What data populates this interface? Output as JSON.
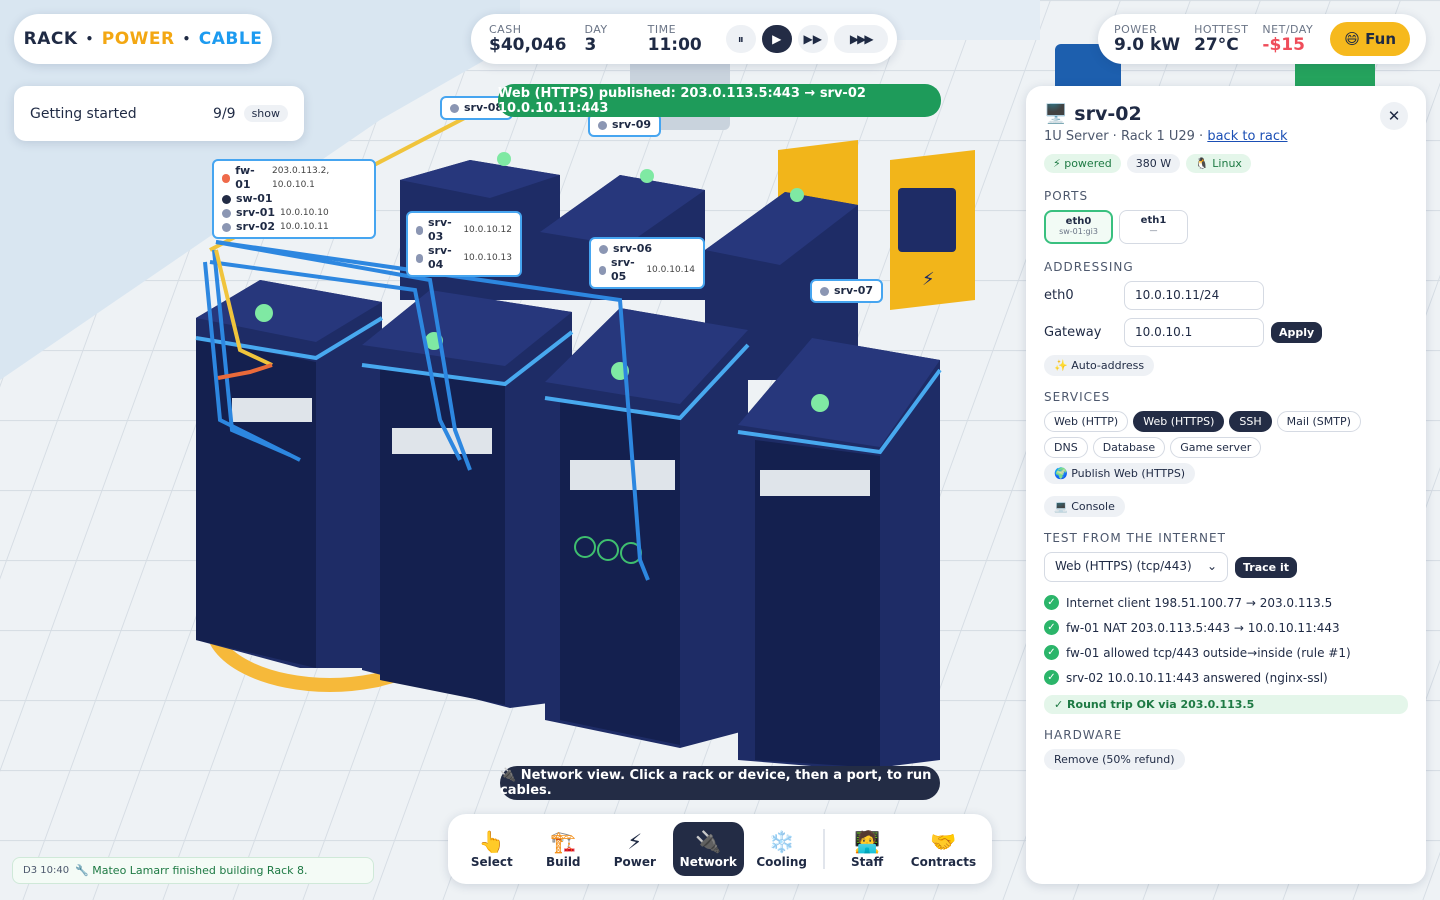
{
  "brand": {
    "w1": "RACK",
    "w2": "POWER",
    "w3": "CABLE",
    "sep": "•"
  },
  "getting_started": {
    "label": "Getting started",
    "count": "9/9",
    "show": "show"
  },
  "topbar": {
    "cash_k": "CASH",
    "cash_v": "$40,046",
    "day_k": "DAY",
    "day_v": "3",
    "time_k": "TIME",
    "time_v": "11:00",
    "pause": "⏸",
    "play": "▶",
    "ff": "▶▶",
    "fff": "▶▶▶"
  },
  "rightbar": {
    "power_k": "POWER",
    "power_v": "9.0 kW",
    "hot_k": "HOTTEST",
    "hot_v": "27°C",
    "net_k": "NET/DAY",
    "net_v": "-$15",
    "fun": "😄 Fun"
  },
  "toast": "Web (HTTPS) published: 203.0.113.5:443 → srv-02 10.0.10.11:443",
  "panel": {
    "title": "🖥️ srv-02",
    "sub": "1U Server · Rack 1 U29 · ",
    "back": "back to rack",
    "close": "✕",
    "tags": [
      "⚡ powered",
      "380 W",
      "🐧 Linux"
    ],
    "ports_h": "PORTS",
    "ports": [
      {
        "name": "eth0",
        "peer": "sw-01:gi3"
      },
      {
        "name": "eth1",
        "peer": "—"
      }
    ],
    "addr_h": "ADDRESSING",
    "eth0_l": "eth0",
    "eth0_v": "10.0.10.11/24",
    "gw_l": "Gateway",
    "gw_v": "10.0.10.1",
    "apply": "Apply",
    "auto": "✨ Auto-address",
    "svc_h": "SERVICES",
    "services": [
      "Web (HTTP)",
      "Web (HTTPS)",
      "SSH",
      "Mail (SMTP)",
      "DNS",
      "Database",
      "Game server"
    ],
    "publish": "🌍 Publish Web (HTTPS)",
    "console": "💻 Console",
    "test_h": "TEST FROM THE INTERNET",
    "test_sel": "Web (HTTPS) (tcp/443)",
    "trace": "Trace it",
    "checks": [
      "Internet client 198.51.100.77 → 203.0.113.5",
      "fw-01 NAT 203.0.113.5:443 → 10.0.10.11:443",
      "fw-01 allowed tcp/443 outside→inside (rule #1)",
      "srv-02 10.0.10.11:443 answered (nginx-ssl)"
    ],
    "ok": "✓ Round trip OK via 203.0.113.5",
    "hw_h": "HARDWARE",
    "remove": "Remove (50% refund)"
  },
  "scene_labels": {
    "fw01": "fw-01",
    "fw01_ip": "203.0.113.2, 10.0.10.1",
    "sw01": "sw-01",
    "srv01": "srv-01",
    "srv01_ip": "10.0.10.10",
    "srv02": "srv-02",
    "srv02_ip": "10.0.10.11",
    "srv03": "srv-03",
    "srv03_ip": "10.0.10.12",
    "srv04": "srv-04",
    "srv04_ip": "10.0.10.13",
    "srv05": "srv-05",
    "srv05_ip": "10.0.10.14",
    "srv06": "srv-06",
    "srv07": "srv-07",
    "srv08": "srv-08",
    "srv09": "srv-09"
  },
  "hint": "🔌 Network view. Click a rack or device, then a port, to run cables.",
  "tools": [
    {
      "icon": "👆",
      "label": "Select"
    },
    {
      "icon": "🏗️",
      "label": "Build"
    },
    {
      "icon": "⚡",
      "label": "Power"
    },
    {
      "icon": "🔌",
      "label": "Network"
    },
    {
      "icon": "❄️",
      "label": "Cooling"
    },
    {
      "icon": "🧑‍💻",
      "label": "Staff"
    },
    {
      "icon": "🤝",
      "label": "Contracts"
    }
  ],
  "log": {
    "time": "D3 10:40",
    "msg": "🔧 Mateo Lamarr finished building Rack 8."
  },
  "colors": {
    "rack": "#1e2c66",
    "rack_top": "#27377c",
    "cable": "#2d87e0",
    "accent_green": "#1e9b5a",
    "brand_orange": "#f3a712",
    "brand_blue": "#1d9bf0"
  }
}
